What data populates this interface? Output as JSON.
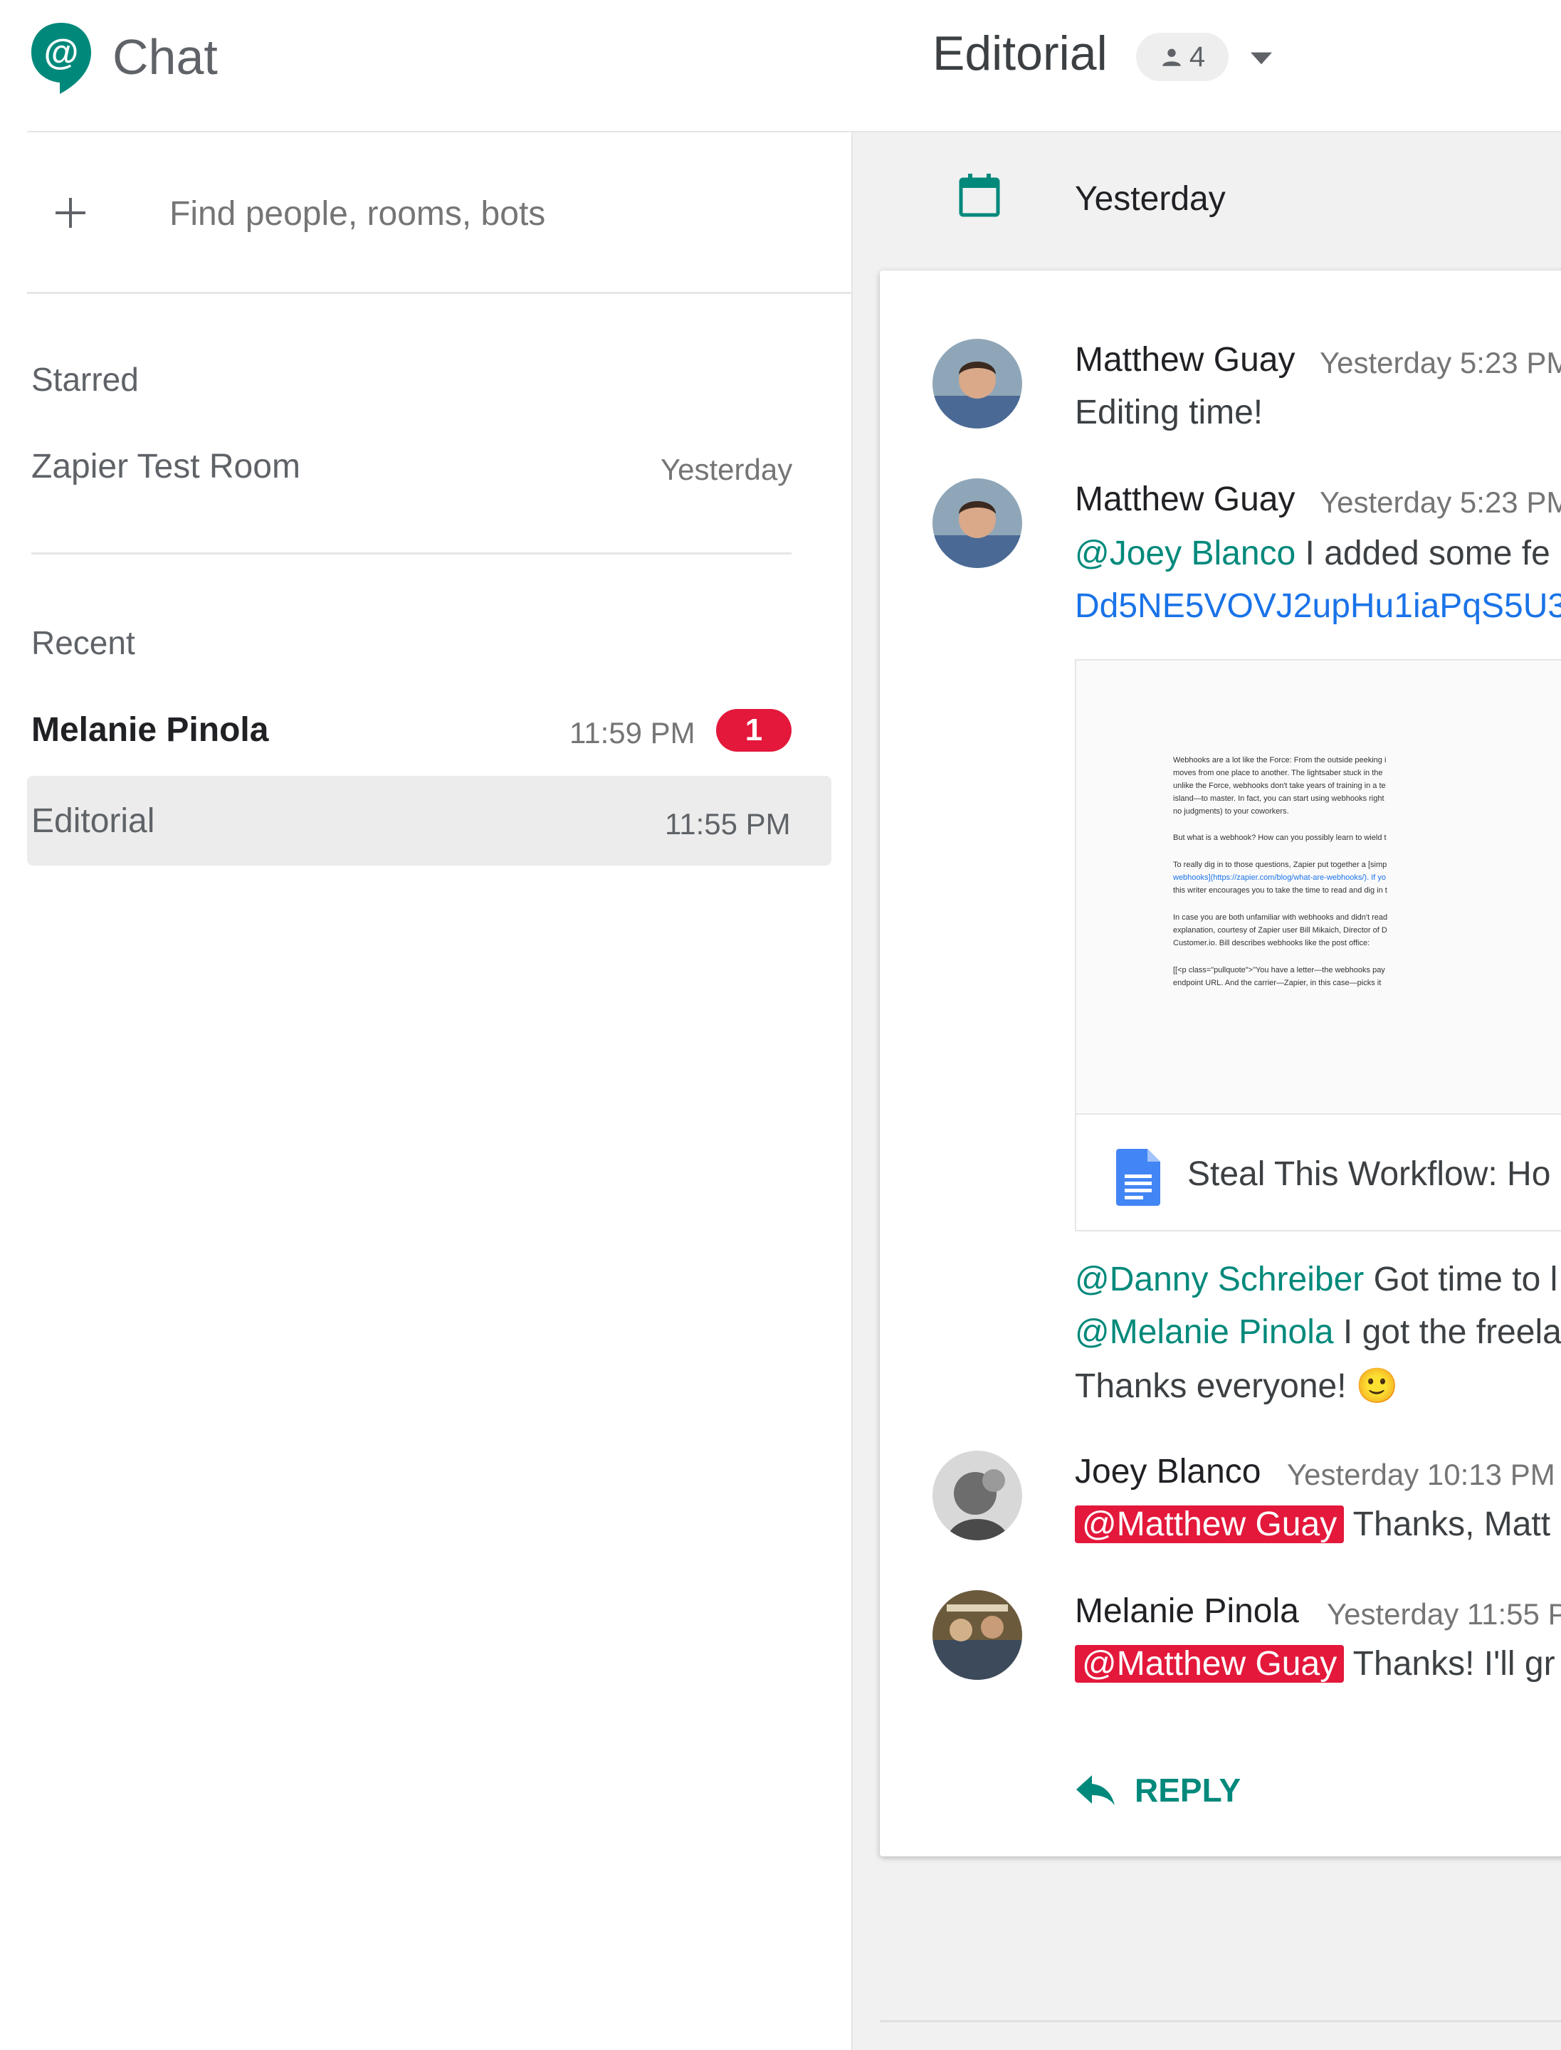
{
  "header": {
    "app_title": "Chat",
    "room_title": "Editorial",
    "member_count": "4",
    "brand_color": "#00897b"
  },
  "sidebar": {
    "search_placeholder": "Find people, rooms, bots",
    "starred_label": "Starred",
    "starred_items": [
      {
        "name": "Zapier Test Room",
        "time": "Yesterday"
      }
    ],
    "recent_label": "Recent",
    "recent_items": [
      {
        "name": "Melanie Pinola",
        "time": "11:59 PM",
        "unread": "1"
      },
      {
        "name": "Editorial",
        "time": "11:55 PM"
      }
    ]
  },
  "thread": {
    "date_label": "Yesterday",
    "messages": [
      {
        "sender": "Matthew Guay",
        "time": "Yesterday 5:23 PM",
        "text": "Editing time!"
      },
      {
        "sender": "Matthew Guay",
        "time": "Yesterday 5:23 PM",
        "mention": "@Joey Blanco",
        "text": " I added some fe",
        "link": "Dd5NE5VOVJ2upHu1iaPqS5U3"
      },
      {
        "mention": "@Danny Schreiber",
        "text": " Got time to l"
      },
      {
        "mention": "@Melanie Pinola",
        "text": " I got the freela"
      },
      {
        "text": "Thanks everyone!",
        "emoji": "🙂"
      },
      {
        "sender": "Joey Blanco",
        "time": "Yesterday 10:13 PM",
        "mention": "@Matthew Guay",
        "text": " Thanks, Matt"
      },
      {
        "sender": "Melanie Pinola",
        "time": "Yesterday 11:55 P",
        "mention": "@Matthew Guay",
        "text": " Thanks! I'll gr"
      }
    ],
    "attachment": {
      "title": "Steal This Workflow: Ho",
      "preview_lines": [
        "Webhooks are a lot like the Force: From the outside peeking i",
        "moves from one place to another. The lightsaber stuck in the",
        "unlike the Force, webhooks don't take years of training in a te",
        "island—to master. In fact, you can start using webhooks right",
        "no judgments) to your coworkers.",
        "But what is a webhook? How can you possibly learn to wield t",
        "To really dig in to those questions, Zapier put together a [simp",
        "webhooks](https://zapier.com/blog/what-are-webhooks/). If yo",
        "this writer encourages you to take the time to read and dig in t",
        "In case you are both unfamiliar with webhooks and didn't read",
        "explanation, courtesy of Zapier user Bill Mikaich, Director of D",
        "Customer.io. Bill describes webhooks like the post office:",
        "[[<p class=\"pullquote\">\"You have a letter—the webhooks pay",
        "endpoint URL. And the carrier—Zapier, in this case—picks it"
      ]
    },
    "reply_label": "REPLY"
  }
}
